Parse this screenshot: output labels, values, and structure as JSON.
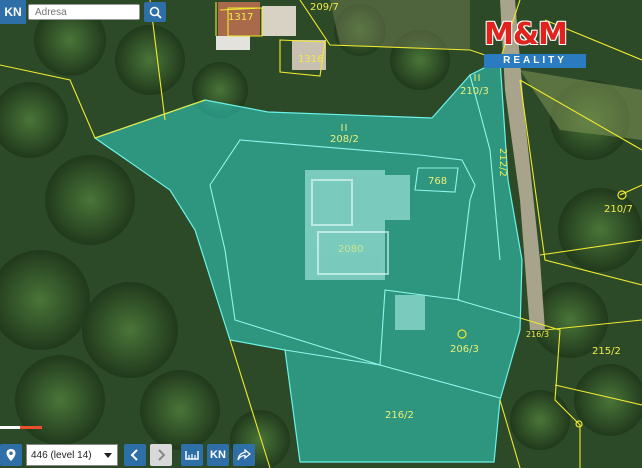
{
  "header": {
    "kn_label": "KN",
    "search_placeholder": "Adresa",
    "search_icon": "search-icon"
  },
  "logo": {
    "main": "M&M",
    "sub": "REALITY",
    "colors": {
      "main": "#e2221c",
      "sub_bg": "#2a7bc0"
    }
  },
  "parcels": {
    "p1317": "1317",
    "p1316": "1316",
    "p209_7": "209/7",
    "p210_3": "210/3",
    "p208_2": "208/2",
    "p768": "768",
    "p212_2": "212/2",
    "p210_7": "210/7",
    "p2080": "2080",
    "p206_3": "206/3",
    "p215_2": "215/2",
    "p216_2": "216/2",
    "p216_3": "216/3"
  },
  "toolbar": {
    "location_icon": "map-marker-icon",
    "level": "446 (level 14)",
    "back_icon": "chevron-left-icon",
    "forward_icon": "chevron-right-icon",
    "ruler_icon": "measure-icon",
    "kn_label": "KN",
    "share_icon": "share-icon"
  },
  "colors": {
    "highlight": "#2fe0d8",
    "boundary": "#f0e830",
    "accent": "#2f6fa8"
  }
}
